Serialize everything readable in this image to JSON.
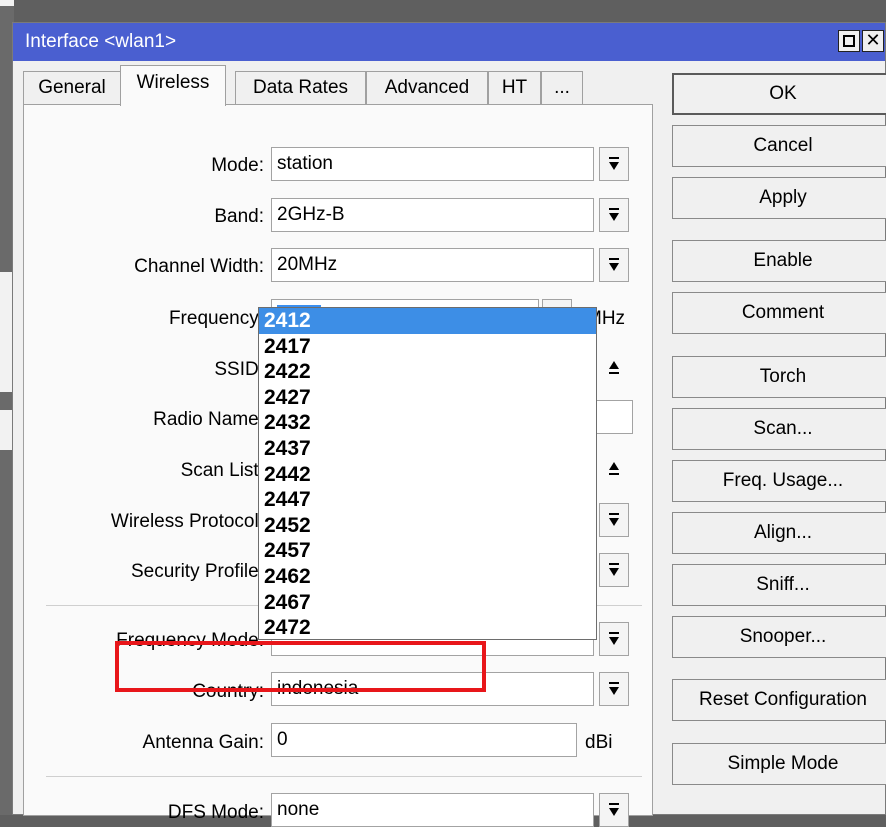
{
  "window": {
    "title": "Interface <wlan1>"
  },
  "tabs": [
    {
      "label": "General"
    },
    {
      "label": "Wireless"
    },
    {
      "label": "Data Rates"
    },
    {
      "label": "Advanced"
    },
    {
      "label": "HT"
    },
    {
      "label": "..."
    }
  ],
  "form": {
    "mode": {
      "label": "Mode:",
      "value": "station"
    },
    "band": {
      "label": "Band:",
      "value": "2GHz-B"
    },
    "channel_width": {
      "label": "Channel Width:",
      "value": "20MHz"
    },
    "frequency": {
      "label": "Frequency:",
      "value": "2412",
      "unit": "MHz"
    },
    "ssid": {
      "label": "SSID:"
    },
    "radio_name": {
      "label": "Radio Name:"
    },
    "scan_list": {
      "label": "Scan List:"
    },
    "wireless_protocol": {
      "label": "Wireless Protocol:"
    },
    "security_profile": {
      "label": "Security Profile:"
    },
    "frequency_mode": {
      "label": "Frequency Mode:"
    },
    "country": {
      "label": "Country:",
      "value": "indonesia"
    },
    "antenna_gain": {
      "label": "Antenna Gain:",
      "value": "0",
      "unit": "dBi"
    },
    "dfs_mode": {
      "label": "DFS Mode:",
      "value": "none"
    }
  },
  "frequency_options": [
    "2412",
    "2417",
    "2422",
    "2427",
    "2432",
    "2437",
    "2442",
    "2447",
    "2452",
    "2457",
    "2462",
    "2467",
    "2472"
  ],
  "buttons": {
    "ok": "OK",
    "cancel": "Cancel",
    "apply": "Apply",
    "enable": "Enable",
    "comment": "Comment",
    "torch": "Torch",
    "scan": "Scan...",
    "freq_usage": "Freq. Usage...",
    "align": "Align...",
    "sniff": "Sniff...",
    "snooper": "Snooper...",
    "reset_configuration": "Reset Configuration",
    "simple_mode": "Simple Mode"
  },
  "colors": {
    "titlebar": "#4a5fd0",
    "selection": "#3d8ee6",
    "highlight": "#e8161a"
  }
}
